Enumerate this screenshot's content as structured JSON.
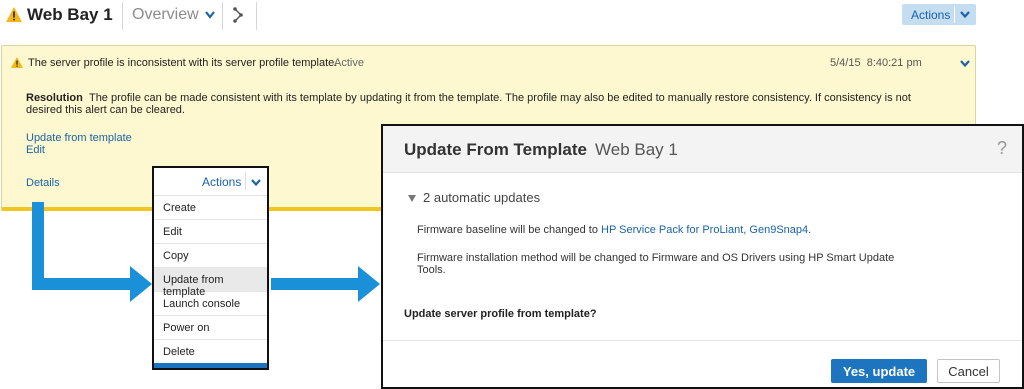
{
  "header": {
    "title": "Web Bay 1",
    "view": "Overview",
    "actions_label": "Actions"
  },
  "alert": {
    "message": "The server profile is inconsistent with its server profile template.",
    "state": "Active",
    "date": "5/4/15",
    "time": "8:40:21 pm",
    "resolution_label": "Resolution",
    "resolution_text": "The profile can be made consistent with its template by updating it from the template. The profile may also be edited to manually restore consistency. If consistency is not desired this alert can be cleared.",
    "link_update": "Update from template",
    "link_edit": "Edit",
    "link_details": "Details"
  },
  "actions_menu": {
    "label": "Actions",
    "items": [
      "Create",
      "Edit",
      "Copy",
      "Update from template",
      "Launch console",
      "Power on",
      "Delete"
    ],
    "highlighted_item": "Update from template"
  },
  "dialog": {
    "title": "Update From Template",
    "subtitle": "Web Bay 1",
    "help": "?",
    "updates_summary": "2 automatic updates",
    "update1_prefix": "Firmware baseline will be changed to ",
    "update1_link": "HP Service Pack for ProLiant, Gen9Snap4",
    "update1_suffix": ".",
    "update2_line1": "Firmware installation method will be changed to Firmware and OS Drivers using HP Smart Update",
    "update2_line2": "Tools.",
    "question": "Update server profile from template?",
    "confirm_label": "Yes, update",
    "cancel_label": "Cancel"
  },
  "colors": {
    "accent_blue": "#1d74bf",
    "warning_yellow": "#f2c51f",
    "alert_background": "#fdf8cf",
    "arrow_blue": "#1a90d9"
  }
}
